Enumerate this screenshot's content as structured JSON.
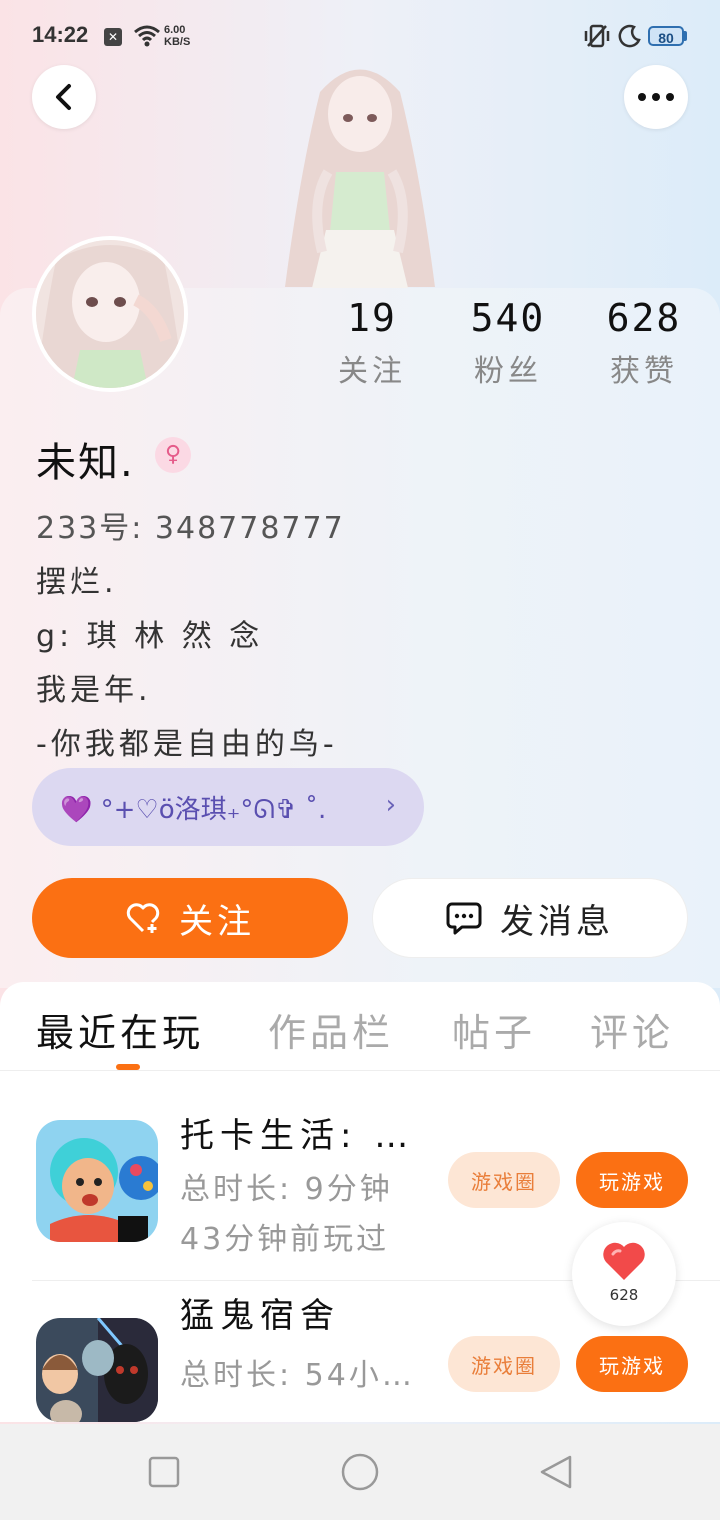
{
  "status_bar": {
    "time": "14:22",
    "net_speed_value": "6.00",
    "net_speed_unit": "KB/S",
    "battery": "80"
  },
  "profile": {
    "stats": [
      {
        "value": "19",
        "label": "关注"
      },
      {
        "value": "540",
        "label": "粉丝"
      },
      {
        "value": "628",
        "label": "获赞"
      }
    ],
    "username": "未知.",
    "gender_symbol": "♀",
    "uid": "233号: 348778777",
    "bio_lines": [
      "摆烂.",
      "g: 琪 林 然 念",
      "我是年.",
      "-你我都是自由的鸟-"
    ],
    "club_text": "💜 °+♡ö洛琪₊°ᘏ✞ ˚.",
    "club_arrow": "›"
  },
  "actions": {
    "follow_label": "关注",
    "message_label": "发消息"
  },
  "tabs": [
    {
      "label": "最近在玩",
      "active": true
    },
    {
      "label": "作品栏",
      "active": false
    },
    {
      "label": "帖子",
      "active": false
    },
    {
      "label": "评论",
      "active": false
    }
  ],
  "games": [
    {
      "title": "托卡生活: …",
      "duration": "总时长: 9分钟",
      "last_played": "43分钟前玩过",
      "circle_label": "游戏圈",
      "play_label": "玩游戏"
    },
    {
      "title": "猛鬼宿舍",
      "duration": "总时长: 54小…",
      "last_played": "",
      "circle_label": "游戏圈",
      "play_label": "玩游戏"
    }
  ],
  "like_fab": {
    "count": "628"
  },
  "colors": {
    "accent": "#fb7013",
    "club_bg": "#dcd8f1"
  }
}
